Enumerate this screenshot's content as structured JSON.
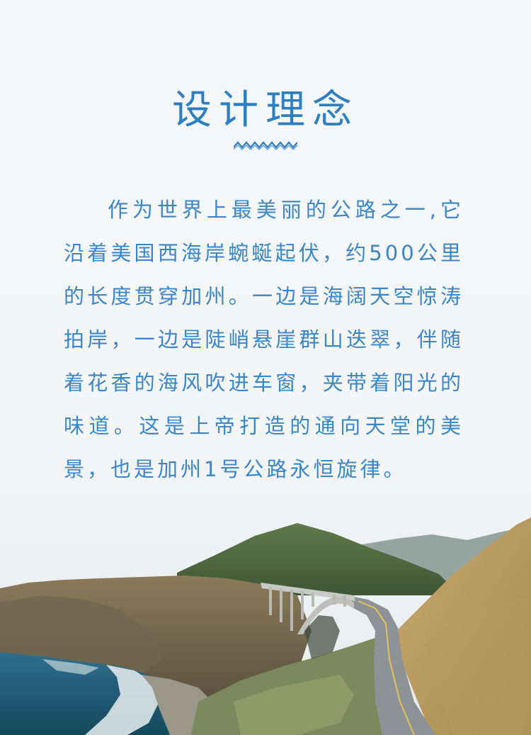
{
  "heading": {
    "title": "设计理念"
  },
  "content": {
    "paragraph": "作为世界上最美丽的公路之一,它沿着美国西海岸蜿蜒起伏，约500公里的长度贯穿加州。一边是海阔天空惊涛拍岸，一边是陡峭悬崖群山迭翠，伴随着花香的海风吹进车窗，夹带着阳光的味道。这是上帝打造的通向天堂的美景，也是加州1号公路永恒旋律。"
  },
  "colors": {
    "accent": "#2e7fc2",
    "text": "#3a86c6",
    "background": "#f3f5f7"
  },
  "decorations": {
    "divider_icon": "wave-divider-icon",
    "scene_icon": "coastal-highway-bridge-illustration"
  }
}
